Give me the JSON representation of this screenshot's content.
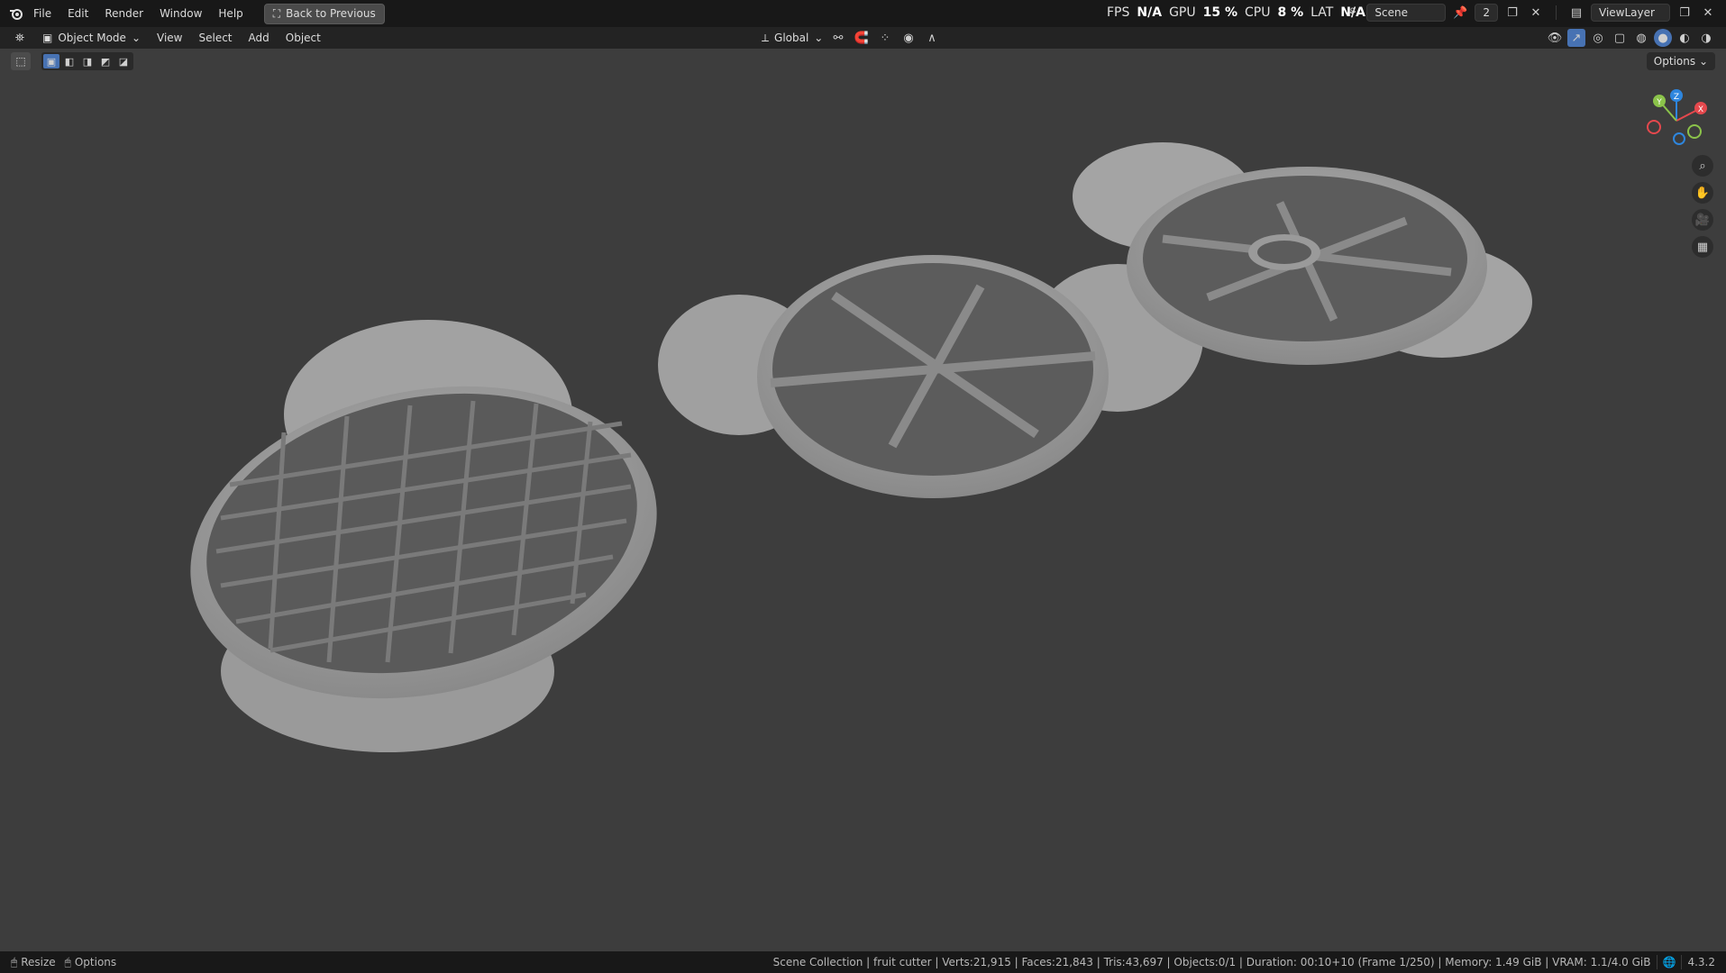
{
  "topbar": {
    "menus": [
      "File",
      "Edit",
      "Render",
      "Window",
      "Help"
    ],
    "back_label": "Back to Previous",
    "scene_name": "Scene",
    "scene_count": "2",
    "view_layer": "ViewLayer"
  },
  "perf": {
    "fps_label": "FPS",
    "fps_value": "N/A",
    "gpu_label": "GPU",
    "gpu_value": "15 %",
    "cpu_label": "CPU",
    "cpu_value": "8 %",
    "lat_label": "LAT",
    "lat_value": "N/A"
  },
  "header": {
    "mode": "Object Mode",
    "menus": [
      "View",
      "Select",
      "Add",
      "Object"
    ],
    "orientation": "Global",
    "options_label": "Options"
  },
  "gizmo": {
    "x": "X",
    "y": "Y",
    "z": "Z",
    "x_color": "#e5484d",
    "y_color": "#8bc34a",
    "z_color": "#2e86de"
  },
  "status": {
    "left_items": [
      "Resize",
      "Options"
    ],
    "info": "Scene Collection | fruit cutter | Verts:21,915 | Faces:21,843 | Tris:43,697 | Objects:0/1 | Duration: 00:10+10 (Frame 1/250) | Memory: 1.49 GiB | VRAM: 1.1/4.0 GiB",
    "version": "4.3.2"
  },
  "colors": {
    "accent": "#4772b3",
    "viewport_bg": "#3d3d3d",
    "object": "#a6a6a6"
  }
}
